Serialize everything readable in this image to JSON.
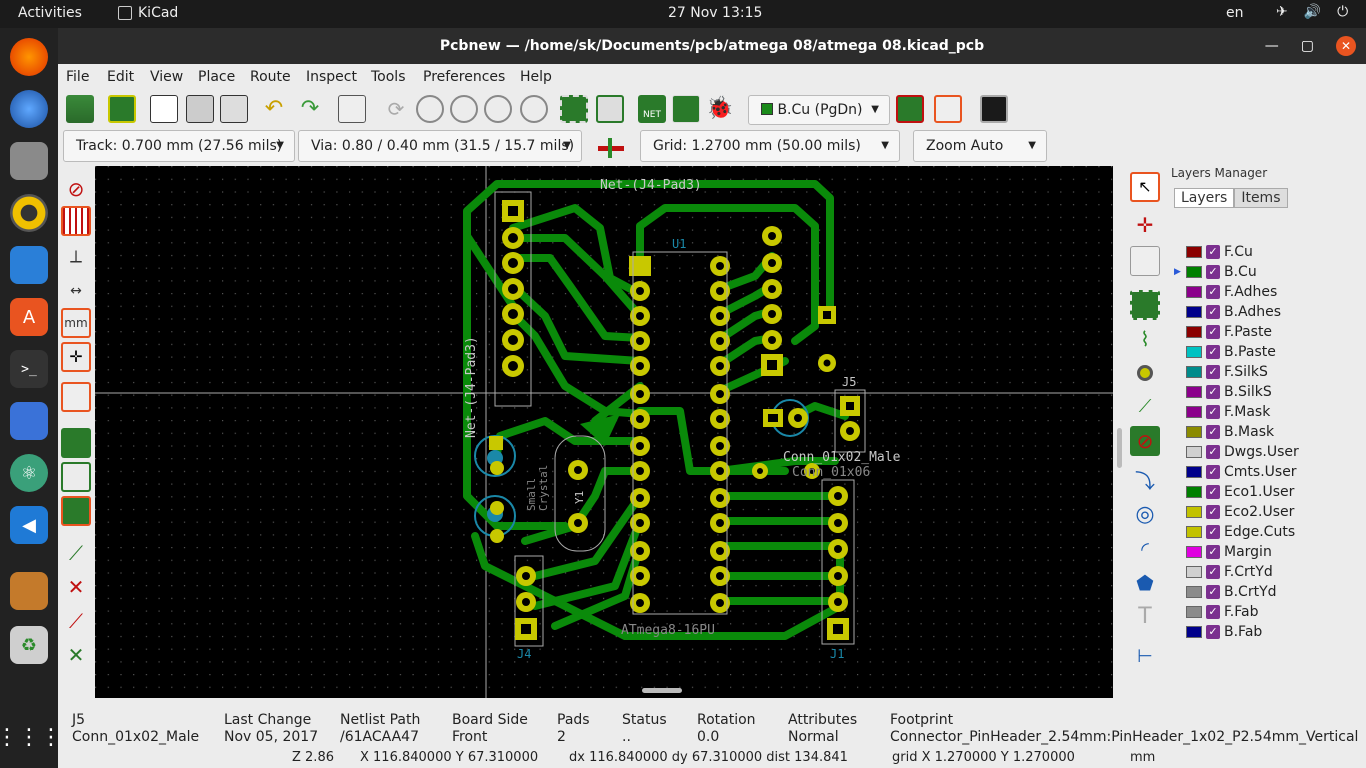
{
  "topbar": {
    "activities": "Activities",
    "app_name": "KiCad",
    "clock": "27 Nov  13:15",
    "language": "en"
  },
  "window": {
    "title": "Pcbnew — /home/sk/Documents/pcb/atmega 08/atmega 08.kicad_pcb"
  },
  "menu": [
    "File",
    "Edit",
    "View",
    "Place",
    "Route",
    "Inspect",
    "Tools",
    "Preferences",
    "Help"
  ],
  "toolbar": {
    "layer_select": "B.Cu (PgDn)",
    "track": "Track: 0.700 mm (27.56 mils)",
    "via": "Via: 0.80 / 0.40 mm (31.5 / 15.7 mils) *",
    "grid": "Grid: 1.2700 mm (50.00 mils)",
    "zoom": "Zoom Auto"
  },
  "layers_manager": {
    "title": "Layers Manager",
    "tabs": [
      "Layers",
      "Items"
    ],
    "active_layer": "B.Cu",
    "layers": [
      {
        "name": "F.Cu",
        "color": "#8b0000"
      },
      {
        "name": "B.Cu",
        "color": "#008000"
      },
      {
        "name": "F.Adhes",
        "color": "#8b008b"
      },
      {
        "name": "B.Adhes",
        "color": "#00008b"
      },
      {
        "name": "F.Paste",
        "color": "#8b0000"
      },
      {
        "name": "B.Paste",
        "color": "#00c2c2"
      },
      {
        "name": "F.SilkS",
        "color": "#008b8b"
      },
      {
        "name": "B.SilkS",
        "color": "#8b008b"
      },
      {
        "name": "F.Mask",
        "color": "#8b008b"
      },
      {
        "name": "B.Mask",
        "color": "#8b8b00"
      },
      {
        "name": "Dwgs.User",
        "color": "#d0d0d0"
      },
      {
        "name": "Cmts.User",
        "color": "#00008b"
      },
      {
        "name": "Eco1.User",
        "color": "#008000"
      },
      {
        "name": "Eco2.User",
        "color": "#c2c200"
      },
      {
        "name": "Edge.Cuts",
        "color": "#c2c200"
      },
      {
        "name": "Margin",
        "color": "#e000e0"
      },
      {
        "name": "F.CrtYd",
        "color": "#d0d0d0"
      },
      {
        "name": "B.CrtYd",
        "color": "#8b8b8b"
      },
      {
        "name": "F.Fab",
        "color": "#8b8b8b"
      },
      {
        "name": "B.Fab",
        "color": "#00008b"
      }
    ]
  },
  "board": {
    "net_label_top": "Net-(J4-Pad3)",
    "net_label_side": "Net-(J4-Pad3)",
    "u1_ref": "U1",
    "u1_value": "ATmega8-16PU",
    "j5_ref": "J5",
    "j5_value": "Conn_01x02_Male",
    "j4_ref": "J4",
    "j1_ref": "J1",
    "j1_value": "Conn_01x06",
    "y1_ref": "Y1",
    "crystal_label": "Crystal",
    "small_label": "Small"
  },
  "message_panel": [
    {
      "label": "J5",
      "value": "Conn_01x02_Male"
    },
    {
      "label": "Last Change",
      "value": "Nov 05, 2017"
    },
    {
      "label": "Netlist Path",
      "value": "/61ACAA47"
    },
    {
      "label": "Board Side",
      "value": "Front"
    },
    {
      "label": "Pads",
      "value": "2"
    },
    {
      "label": "Status",
      "value": ".."
    },
    {
      "label": "Rotation",
      "value": "0.0"
    },
    {
      "label": "Attributes",
      "value": "Normal"
    },
    {
      "label": "Footprint",
      "value": "Connector_PinHeader_2.54mm:PinHeader_1x02_P2.54mm_Vertical"
    }
  ],
  "status": {
    "zoom": "Z 2.86",
    "xy": "X 116.840000  Y 67.310000",
    "dxdy": "dx 116.840000  dy 67.310000  dist 134.841",
    "grid": "grid X 1.270000  Y 1.270000",
    "units": "mm"
  }
}
